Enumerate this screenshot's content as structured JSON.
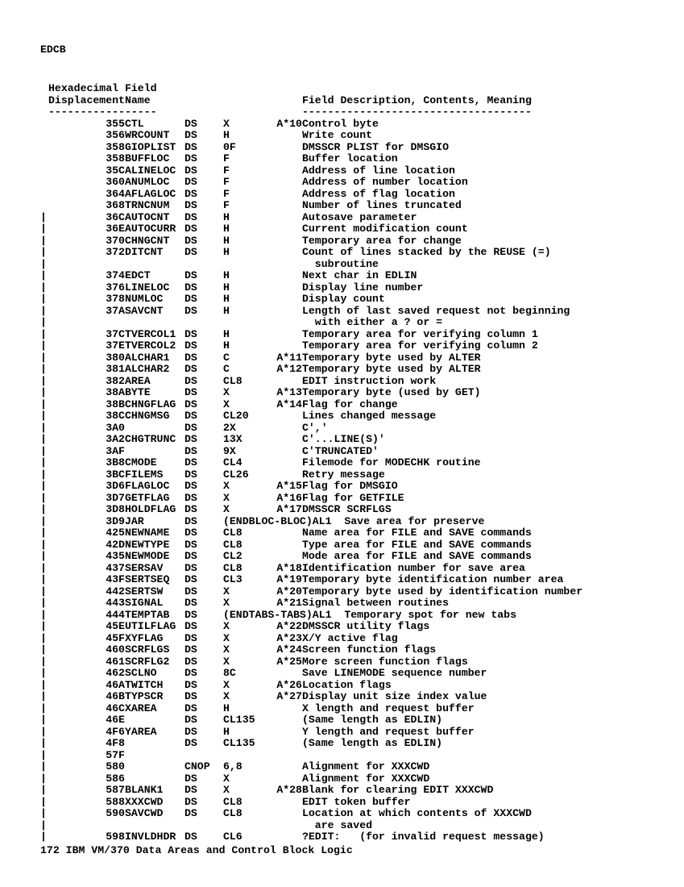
{
  "section_label": "EDCB",
  "header": {
    "line1_disp": "Hexadecimal",
    "line2_disp": "Displacement",
    "line1_name": "Field",
    "line2_name": "Name",
    "line2_desc": "Field Description, Contents, Meaning",
    "sep_disp": "------------",
    "sep_name": "-----",
    "sep_desc": "------------------------------------"
  },
  "rows": [
    {
      "c": "",
      "d": "355",
      "f": "CTL",
      "o": "DS",
      "t": "X",
      "n": "A*10",
      "desc": "Control byte"
    },
    {
      "c": "",
      "d": "356",
      "f": "WRCOUNT",
      "o": "DS",
      "t": "H",
      "n": "",
      "desc": "Write count"
    },
    {
      "c": "",
      "d": "358",
      "f": "GIOPLIST",
      "o": "DS",
      "t": "0F",
      "n": "",
      "desc": "DMSSCR PLIST for DMSGIO"
    },
    {
      "c": "",
      "d": "358",
      "f": "BUFFLOC",
      "o": "DS",
      "t": "F",
      "n": "",
      "desc": "Buffer location"
    },
    {
      "c": "",
      "d": "35C",
      "f": "ALINELOC",
      "o": "DS",
      "t": "F",
      "n": "",
      "desc": "Address of line location"
    },
    {
      "c": "",
      "d": "360",
      "f": "ANUMLOC",
      "o": "DS",
      "t": "F",
      "n": "",
      "desc": "Address of number location"
    },
    {
      "c": "",
      "d": "364",
      "f": "AFLAGLOC",
      "o": "DS",
      "t": "F",
      "n": "",
      "desc": "Address of flag location"
    },
    {
      "c": "",
      "d": "368",
      "f": "TRNCNUM",
      "o": "DS",
      "t": "F",
      "n": "",
      "desc": "Number of lines truncated"
    },
    {
      "c": "|",
      "d": "36C",
      "f": "AUTOCNT",
      "o": "DS",
      "t": "H",
      "n": "",
      "desc": "Autosave parameter"
    },
    {
      "c": "|",
      "d": "36E",
      "f": "AUTOCURR",
      "o": "DS",
      "t": "H",
      "n": "",
      "desc": "Current modification count"
    },
    {
      "c": "|",
      "d": "370",
      "f": "CHNGCNT",
      "o": "DS",
      "t": "H",
      "n": "",
      "desc": "Temporary area for change"
    },
    {
      "c": "|",
      "d": "372",
      "f": "DITCNT",
      "o": "DS",
      "t": "H",
      "n": "",
      "desc": "Count of lines stacked by the REUSE (=)"
    },
    {
      "c": "|",
      "d": "",
      "f": "",
      "o": "",
      "t": "",
      "n": "",
      "desc": "  subroutine"
    },
    {
      "c": "|",
      "d": "374",
      "f": "EDCT",
      "o": "DS",
      "t": "H",
      "n": "",
      "desc": "Next char in EDLIN"
    },
    {
      "c": "|",
      "d": "376",
      "f": "LINELOC",
      "o": "DS",
      "t": "H",
      "n": "",
      "desc": "Display line number"
    },
    {
      "c": "|",
      "d": "378",
      "f": "NUMLOC",
      "o": "DS",
      "t": "H",
      "n": "",
      "desc": "Display count"
    },
    {
      "c": "|",
      "d": "37A",
      "f": "SAVCNT",
      "o": "DS",
      "t": "H",
      "n": "",
      "desc": "Length of last saved request not beginning"
    },
    {
      "c": "|",
      "d": "",
      "f": "",
      "o": "",
      "t": "",
      "n": "",
      "desc": "  with either a ? or ="
    },
    {
      "c": "|",
      "d": "37C",
      "f": "TVERCOL1",
      "o": "DS",
      "t": "H",
      "n": "",
      "desc": "Temporary area for verifying column 1"
    },
    {
      "c": "|",
      "d": "37E",
      "f": "TVERCOL2",
      "o": "DS",
      "t": "H",
      "n": "",
      "desc": "Temporary area for verifying column 2"
    },
    {
      "c": "|",
      "d": "380",
      "f": "ALCHAR1",
      "o": "DS",
      "t": "C",
      "n": "A*11",
      "desc": "Temporary byte used by ALTER"
    },
    {
      "c": "|",
      "d": "381",
      "f": "ALCHAR2",
      "o": "DS",
      "t": "C",
      "n": "A*12",
      "desc": "Temporary byte used by ALTER"
    },
    {
      "c": "|",
      "d": "382",
      "f": "AREA",
      "o": "DS",
      "t": "CL8",
      "n": "",
      "desc": "EDIT instruction work"
    },
    {
      "c": "|",
      "d": "38A",
      "f": "BYTE",
      "o": "DS",
      "t": "X",
      "n": "A*13",
      "desc": "Temporary byte (used by GET)"
    },
    {
      "c": "|",
      "d": "38B",
      "f": "CHNGFLAG",
      "o": "DS",
      "t": "X",
      "n": "A*14",
      "desc": "Flag for change"
    },
    {
      "c": "|",
      "d": "38C",
      "f": "CHNGMSG",
      "o": "DS",
      "t": "CL20",
      "n": "",
      "desc": "Lines changed message"
    },
    {
      "c": "|",
      "d": "3A0",
      "f": "",
      "o": "DS",
      "t": "2X",
      "n": "",
      "desc": "C','"
    },
    {
      "c": "|",
      "d": "3A2",
      "f": "CHGTRUNC",
      "o": "DS",
      "t": "13X",
      "n": "",
      "desc": "C'...LINE(S)'"
    },
    {
      "c": "|",
      "d": "3AF",
      "f": "",
      "o": "DS",
      "t": "9X",
      "n": "",
      "desc": "C'TRUNCATED'"
    },
    {
      "c": "|",
      "d": "3B8",
      "f": "CMODE",
      "o": "DS",
      "t": "CL4",
      "n": "",
      "desc": "Filemode for MODECHK routine"
    },
    {
      "c": "|",
      "d": "3BC",
      "f": "FILEMS",
      "o": "DS",
      "t": "CL26",
      "n": "",
      "desc": "Retry message"
    },
    {
      "c": "|",
      "d": "3D6",
      "f": "FLAGLOC",
      "o": "DS",
      "t": "X",
      "n": "A*15",
      "desc": "Flag for DMSGIO"
    },
    {
      "c": "|",
      "d": "3D7",
      "f": "GETFLAG",
      "o": "DS",
      "t": "X",
      "n": "A*16",
      "desc": "Flag for GETFILE"
    },
    {
      "c": "|",
      "d": "3D8",
      "f": "HOLDFLAG",
      "o": "DS",
      "t": "X",
      "n": "A*17",
      "desc": "DMSSCR SCRFLGS"
    },
    {
      "c": "|",
      "d": "3D9",
      "f": "JAR",
      "o": "DS",
      "t": "(ENDBLOC-BLOC)AL1",
      "n": "",
      "desc": "  Save area for preserve",
      "span": true
    },
    {
      "c": "|",
      "d": "425",
      "f": "NEWNAME",
      "o": "DS",
      "t": "CL8",
      "n": "",
      "desc": "Name area for FILE and SAVE commands"
    },
    {
      "c": "|",
      "d": "42D",
      "f": "NEWTYPE",
      "o": "DS",
      "t": "CL8",
      "n": "",
      "desc": "Type area for FILE and SAVE commands"
    },
    {
      "c": "|",
      "d": "435",
      "f": "NEWMODE",
      "o": "DS",
      "t": "CL2",
      "n": "",
      "desc": "Mode area for FILE and SAVE commands"
    },
    {
      "c": "|",
      "d": "437",
      "f": "SERSAV",
      "o": "DS",
      "t": "CL8",
      "n": "A*18",
      "desc": "Identification number for save area"
    },
    {
      "c": "|",
      "d": "43F",
      "f": "SERTSEQ",
      "o": "DS",
      "t": "CL3",
      "n": "A*19",
      "desc": "Temporary byte identification number area"
    },
    {
      "c": "|",
      "d": "442",
      "f": "SERTSW",
      "o": "DS",
      "t": "X",
      "n": "A*20",
      "desc": "Temporary byte used by identification number"
    },
    {
      "c": "|",
      "d": "443",
      "f": "SIGNAL",
      "o": "DS",
      "t": "X",
      "n": "A*21",
      "desc": "Signal between routines"
    },
    {
      "c": "|",
      "d": "444",
      "f": "TEMPTAB",
      "o": "DS",
      "t": "(ENDTABS-TABS)AL1",
      "n": "",
      "desc": "  Temporary spot for new tabs",
      "span": true
    },
    {
      "c": "|",
      "d": "45E",
      "f": "UTILFLAG",
      "o": "DS",
      "t": "X",
      "n": "A*22",
      "desc": "DMSSCR utility flags"
    },
    {
      "c": "|",
      "d": "45F",
      "f": "XYFLAG",
      "o": "DS",
      "t": "X",
      "n": "A*23",
      "desc": "X/Y active flag"
    },
    {
      "c": "|",
      "d": "460",
      "f": "SCRFLGS",
      "o": "DS",
      "t": "X",
      "n": "A*24",
      "desc": "Screen function flags"
    },
    {
      "c": "|",
      "d": "461",
      "f": "SCRFLG2",
      "o": "DS",
      "t": "X",
      "n": "A*25",
      "desc": "More screen function flags"
    },
    {
      "c": "|",
      "d": "462",
      "f": "SCLNO",
      "o": "DS",
      "t": "8C",
      "n": "",
      "desc": "Save LINEMODE sequence number"
    },
    {
      "c": "|",
      "d": "46A",
      "f": "TWITCH",
      "o": "DS",
      "t": "X",
      "n": "A*26",
      "desc": "Location flags"
    },
    {
      "c": "|",
      "d": "46B",
      "f": "TYPSCR",
      "o": "DS",
      "t": "X",
      "n": "A*27",
      "desc": "Display unit size index value"
    },
    {
      "c": "|",
      "d": "46C",
      "f": "XAREA",
      "o": "DS",
      "t": "H",
      "n": "",
      "desc": "X length and request buffer"
    },
    {
      "c": "|",
      "d": "46E",
      "f": "",
      "o": "DS",
      "t": "CL135",
      "n": "",
      "desc": "(Same length as EDLIN)"
    },
    {
      "c": "|",
      "d": "4F6",
      "f": "YAREA",
      "o": "DS",
      "t": "H",
      "n": "",
      "desc": "Y length and request buffer"
    },
    {
      "c": "|",
      "d": "4F8",
      "f": "",
      "o": "DS",
      "t": "CL135",
      "n": "",
      "desc": "(Same length as EDLIN)"
    },
    {
      "c": "|",
      "d": "57F",
      "f": "",
      "o": "",
      "t": "",
      "n": "",
      "desc": ""
    },
    {
      "c": "|",
      "d": "580",
      "f": "",
      "o": "CNOP",
      "t": "6,8",
      "n": "",
      "desc": "Alignment for XXXCWD"
    },
    {
      "c": "|",
      "d": "586",
      "f": "",
      "o": "DS",
      "t": "X",
      "n": "",
      "desc": "Alignment for XXXCWD"
    },
    {
      "c": "|",
      "d": "587",
      "f": "BLANK1",
      "o": "DS",
      "t": "X",
      "n": "A*28",
      "desc": "Blank for clearing EDIT XXXCWD"
    },
    {
      "c": "|",
      "d": "588",
      "f": "XXXCWD",
      "o": "DS",
      "t": "CL8",
      "n": "",
      "desc": "EDIT token buffer"
    },
    {
      "c": "|",
      "d": "590",
      "f": "SAVCWD",
      "o": "DS",
      "t": "CL8",
      "n": "",
      "desc": "Location at which contents of XXXCWD"
    },
    {
      "c": "|",
      "d": "",
      "f": "",
      "o": "",
      "t": "",
      "n": "",
      "desc": "  are saved"
    },
    {
      "c": "|",
      "d": "598",
      "f": "INVLDHDR",
      "o": "DS",
      "t": "CL6",
      "n": "",
      "desc": "?EDIT:   (for invalid request message)"
    }
  ],
  "footer": "172   IBM VM/370 Data Areas and Control Block Logic"
}
